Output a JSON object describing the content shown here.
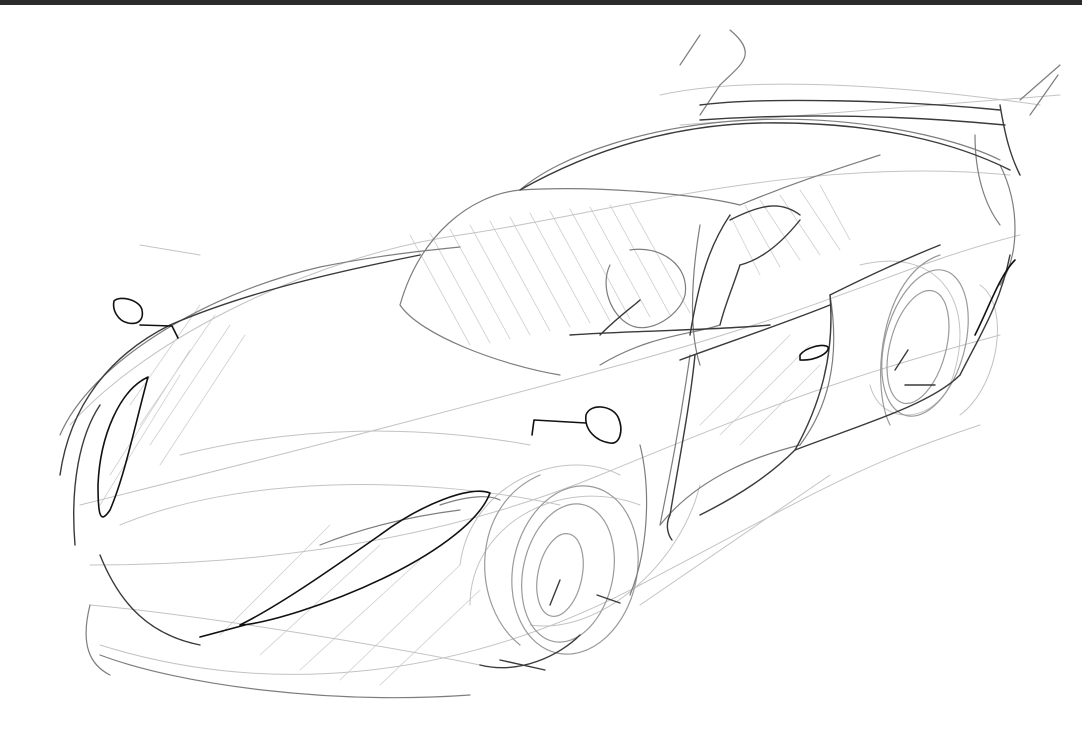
{
  "app": {
    "top_bar_color": "#2b2b2b",
    "canvas_background": "#ffffff"
  },
  "drawing": {
    "subject": "car-sketch",
    "stroke_colors": {
      "light": "#c6c6c6",
      "medium": "#8e8e8e",
      "dark": "#3a3a3a",
      "ink": "#111111"
    }
  }
}
